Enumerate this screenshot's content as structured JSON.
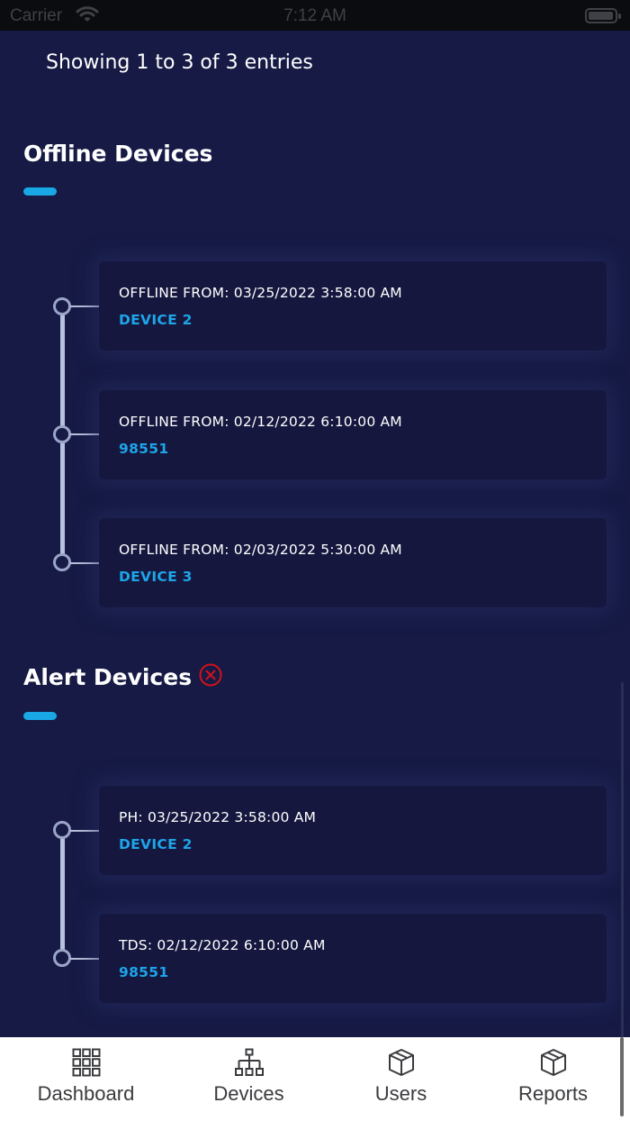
{
  "status_bar": {
    "carrier": "Carrier",
    "time": "7:12 AM",
    "icons": [
      "wifi-icon",
      "battery-icon"
    ]
  },
  "entries_text": "Showing 1 to 3 of 3 entries",
  "offline": {
    "title": "Offline Devices",
    "items": [
      {
        "meta": "OFFLINE FROM: 03/25/2022 3:58:00 AM",
        "device": "DEVICE 2"
      },
      {
        "meta": "OFFLINE FROM: 02/12/2022 6:10:00 AM",
        "device": "98551"
      },
      {
        "meta": "OFFLINE FROM: 02/03/2022 5:30:00 AM",
        "device": "DEVICE 3"
      }
    ]
  },
  "alert": {
    "title": "Alert Devices",
    "icon": "alert-x-icon",
    "items": [
      {
        "meta": "PH: 03/25/2022 3:58:00 AM",
        "device": "DEVICE 2"
      },
      {
        "meta": "TDS: 02/12/2022 6:10:00 AM",
        "device": "98551"
      }
    ]
  },
  "tabs": [
    {
      "label": "Dashboard",
      "icon": "grid-icon"
    },
    {
      "label": "Devices",
      "icon": "hierarchy-icon"
    },
    {
      "label": "Users",
      "icon": "box-icon"
    },
    {
      "label": "Reports",
      "icon": "box-icon"
    }
  ],
  "colors": {
    "background": "#161a45",
    "card": "#15173f",
    "accent": "#1aa7e6",
    "alert": "#d0121b",
    "tab_bar": "#ffffff"
  }
}
